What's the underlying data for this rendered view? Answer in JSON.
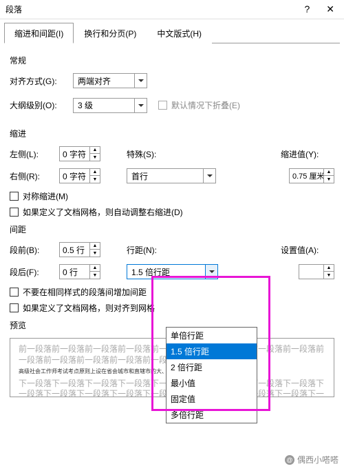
{
  "title": "段落",
  "tabs": {
    "t1": "缩进和间距(I)",
    "t2": "换行和分页(P)",
    "t3": "中文版式(H)"
  },
  "sections": {
    "general": "常规",
    "indent": "缩进",
    "spacing": "间距",
    "preview": "预览"
  },
  "general": {
    "align_label": "对齐方式(G):",
    "align_value": "两端对齐",
    "outline_label": "大纲级别(O):",
    "outline_value": "3 级",
    "collapse": "默认情况下折叠(E)"
  },
  "indent": {
    "left_label": "左侧(L):",
    "left_value": "0 字符",
    "right_label": "右侧(R):",
    "right_value": "0 字符",
    "special_label": "特殊(S):",
    "special_value": "首行",
    "by_label": "缩进值(Y):",
    "by_value": "0.75 厘米",
    "mirror": "对称缩进(M)",
    "grid": "如果定义了文档网格，则自动调整右缩进(D)"
  },
  "spacing": {
    "before_label": "段前(B):",
    "before_value": "0.5 行",
    "after_label": "段后(F):",
    "after_value": "0 行",
    "line_label": "行距(N):",
    "line_value": "1.5 倍行距",
    "at_label": "设置值(A):",
    "at_value": "",
    "nosame": "不要在相同样式的段落间增加间距",
    "grid": "如果定义了文档网格，则对齐到网格"
  },
  "dropdown": [
    "单倍行距",
    "1.5 倍行距",
    "2 倍行距",
    "最小值",
    "固定值",
    "多倍行距"
  ],
  "dropdown_selected": 1,
  "preview_text": {
    "grey": "前一段落前一段落前一段落前一段落前一段落前一段落前一段落前一段落前一段落前一段落前一段落前一段落前一段落前一段落前一段落前一段落",
    "dark": "高级社会工作师考试考点原则上设在省会城市和直辖市的大、中专院校或高考定点学校，",
    "grey2": "下一段落下一段落下一段落下一段落下一段落下一段落下一段落下一段落下一段落下一段落下一段落下一段落下一段落下一段落下一段落下一段落下一段落下一段落下一段落下一段落下一段落下一段落下一段落下一段落下一段落下一段落"
  },
  "watermark": "偶西小嗒嗒"
}
